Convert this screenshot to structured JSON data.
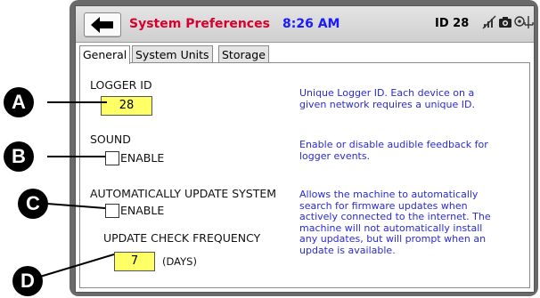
{
  "titlebar": {
    "back_label": "Back",
    "title": "System Preferences",
    "clock": "8:26 AM",
    "logger_badge": "ID 28"
  },
  "tabs": [
    {
      "label": "General",
      "active": true
    },
    {
      "label": "System Units",
      "active": false
    },
    {
      "label": "Storage",
      "active": false
    }
  ],
  "settings": {
    "logger_id": {
      "label": "LOGGER ID",
      "value": "28",
      "help": [
        "Unique Logger ID. Each device on a",
        "given network requires a unique ID."
      ]
    },
    "sound": {
      "label": "SOUND",
      "checkbox_label": "ENABLE",
      "checked": false,
      "help": [
        "Enable or disable audible feedback for",
        "logger events."
      ]
    },
    "auto_update": {
      "label": "AUTOMATICALLY UPDATE SYSTEM",
      "checkbox_label": "ENABLE",
      "checked": false,
      "help": [
        "Allows the machine to automatically",
        "search for firmware updates when",
        "actively connected to the internet. The",
        "machine will not automatically install",
        "any updates, but will prompt when an",
        "update is available."
      ]
    },
    "update_frequency": {
      "label": "UPDATE CHECK FREQUENCY",
      "value": "7",
      "unit": "(DAYS)"
    }
  },
  "callouts": [
    "A",
    "B",
    "C",
    "D"
  ],
  "icons": [
    "back-arrow-icon",
    "no-wifi-icon",
    "camera-icon",
    "gps-icon",
    "usb-icon"
  ],
  "colors": {
    "title": "#d6002e",
    "clock": "#1a1aff",
    "help_text": "#2a2ad6",
    "input_fill": "#ffff66",
    "device_frame": "#6a6a6a"
  }
}
